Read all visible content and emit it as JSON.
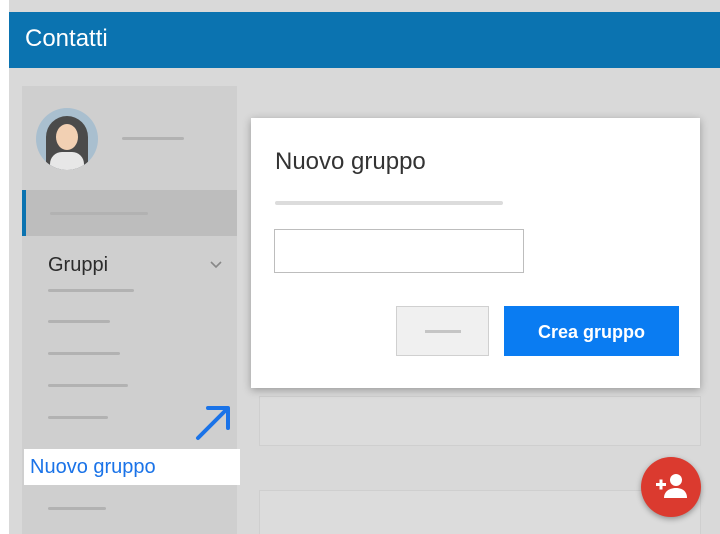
{
  "app": {
    "title": "Contatti"
  },
  "sidebar": {
    "groups_label": "Gruppi",
    "new_group_link": "Nuovo gruppo"
  },
  "dialog": {
    "title": "Nuovo gruppo",
    "input_value": "",
    "create_label": "Crea gruppo"
  },
  "fab": {
    "icon": "add-person-icon"
  },
  "colors": {
    "appbar": "#0b73b0",
    "primary_button": "#0a7cf2",
    "link": "#1a73e8",
    "fab": "#db3a2f"
  }
}
